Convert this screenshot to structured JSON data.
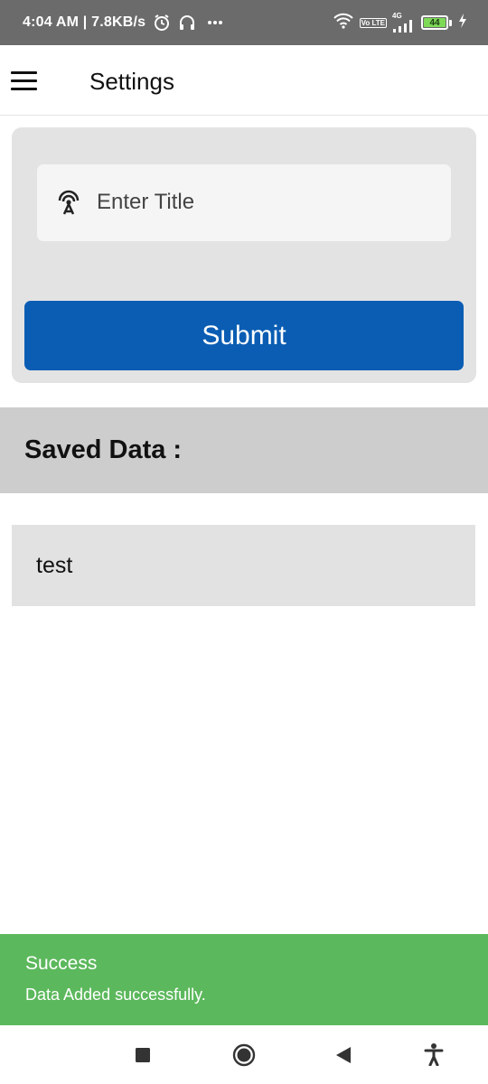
{
  "status_bar": {
    "time_speed": "4:04 AM | 7.8KB/s",
    "network_label": "4G",
    "volte_label": "Vo LTE",
    "battery_level": "44"
  },
  "app_bar": {
    "title": "Settings"
  },
  "form": {
    "title_placeholder": "Enter Title",
    "title_value": "",
    "submit_label": "Submit"
  },
  "saved_section": {
    "heading": "Saved Data :",
    "items": [
      "test"
    ]
  },
  "snackbar": {
    "title": "Success",
    "message": "Data Added successfully.",
    "color": "#5cb85c"
  },
  "colors": {
    "primary": "#0a5db3",
    "status_bar": "#6b6b6b"
  }
}
